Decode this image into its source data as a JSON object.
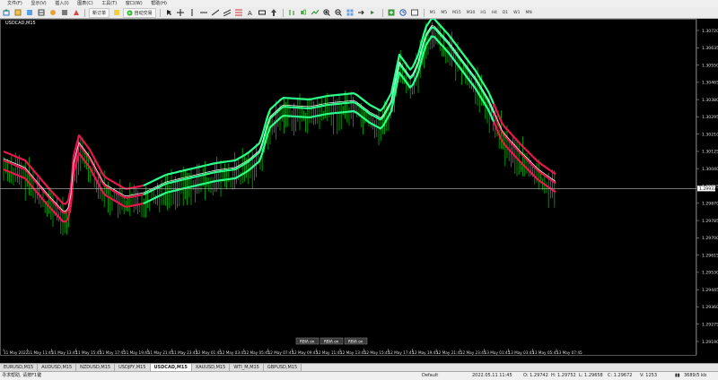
{
  "menu": [
    "文件(F)",
    "显示(V)",
    "插入(I)",
    "图表(C)",
    "工具(T)",
    "窗口(W)",
    "帮助(H)"
  ],
  "toolbar": {
    "new_order": "新订单",
    "auto_trade": "自动交易"
  },
  "timeframes": [
    "M1",
    "M5",
    "M15",
    "M30",
    "H1",
    "H4",
    "D1",
    "W1",
    "MN"
  ],
  "chart": {
    "symbol_label": "USDCAD,M15",
    "current_price": "1.29933",
    "price_ticks": [
      "1.30720",
      "1.30635",
      "1.30550",
      "1.30465",
      "1.30380",
      "1.30295",
      "1.30210",
      "1.30125",
      "1.30040",
      "1.29955",
      "1.29870",
      "1.29785",
      "1.29700",
      "1.29615",
      "1.29530",
      "1.29445",
      "1.29360",
      "1.29275",
      "1.29190"
    ],
    "time_ticks": [
      "11 May 2022",
      "11 May 11:45",
      "11 May 13:45",
      "11 May 15:45",
      "11 May 17:45",
      "11 May 19:45",
      "11 May 21:45",
      "11 May 23:45",
      "12 May 01:45",
      "12 May 03:45",
      "12 May 05:45",
      "12 May 07:45",
      "12 May 09:45",
      "12 May 11:45",
      "12 May 13:45",
      "12 May 15:45",
      "12 May 17:45",
      "12 May 19:45",
      "12 May 21:45",
      "12 May 23:45",
      "13 May 01:45",
      "13 May 03:45",
      "13 May 05:45",
      "13 May 07:45"
    ],
    "buttons": [
      "RBIA on",
      "RBIA on",
      "RBIA on"
    ],
    "colors": {
      "candles": "#00b300",
      "upper_band": "#e8174c",
      "lower_band": "#2bff8c",
      "mid_line": "#ffffff"
    }
  },
  "tabs": [
    "EURUSD,M15",
    "AUDUSD,M15",
    "NZDUSD,M15",
    "USDJPY,M15",
    "USDCAD,M15",
    "XAUUSD,M15",
    "WTI_M,M15",
    "GBPUSD,M15"
  ],
  "active_tab": 4,
  "status": {
    "help": "寻求帮助, 请按F1键",
    "profile": "Default",
    "datetime": "2022.05.11 11:45",
    "open": "O: 1.29742",
    "high": "H: 1.29752",
    "low": "L: 1.29658",
    "close": "C: 1.29672",
    "volume": "V: 1253",
    "traffic": "3689/5 kb"
  }
}
